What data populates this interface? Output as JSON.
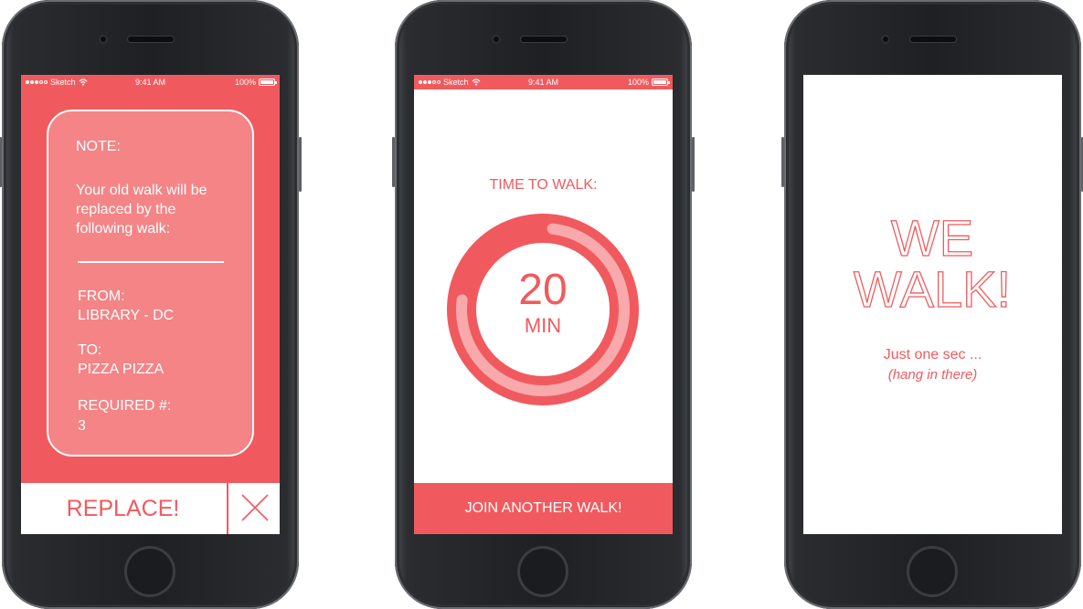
{
  "colors": {
    "accent": "#f05a5e",
    "card": "#f48486",
    "white": "#ffffff",
    "ring_light": "#f8a9ab"
  },
  "status_bar": {
    "carrier": "Sketch",
    "time": "9:41 AM",
    "battery": "100%"
  },
  "screen1": {
    "note_title": "NOTE:",
    "note_body_lines": [
      "Your old walk will be",
      "replaced by the",
      "following walk:"
    ],
    "from_label": "FROM:",
    "from_value": "LIBRARY - DC",
    "to_label": "TO:",
    "to_value": "PIZZA PIZZA",
    "required_label": "REQUIRED #:",
    "required_value": "3",
    "replace_button": "REPLACE!",
    "close_icon": "close-icon"
  },
  "screen2": {
    "title": "TIME TO WALK:",
    "timer_value": "20",
    "timer_unit": "MIN",
    "progress_fraction": 0.75,
    "join_button": "JOIN ANOTHER WALK!"
  },
  "screen3": {
    "logo_line1": "WE",
    "logo_line2": "WALK!",
    "subtitle": "Just one sec ...",
    "subtitle_hint": "(hang in there)"
  }
}
